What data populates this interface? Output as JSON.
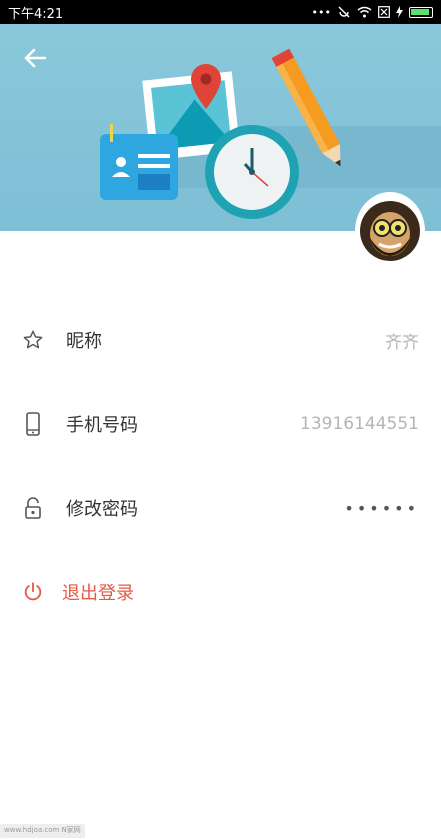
{
  "status_bar": {
    "time": "下午4:21",
    "signal_dots": "•••"
  },
  "header": {
    "back_icon": "arrow-left-icon"
  },
  "profile": {
    "rows": [
      {
        "icon": "star-outline-icon",
        "label": "昵称",
        "value": "齐齐"
      },
      {
        "icon": "phone-icon",
        "label": "手机号码",
        "value": "13916144551"
      },
      {
        "icon": "lock-icon",
        "label": "修改密码",
        "value": "••••••"
      }
    ],
    "logout": {
      "icon": "power-icon",
      "label": "退出登录"
    }
  },
  "watermark": {
    "text": "www.hdjoa.com N家网"
  },
  "colors": {
    "header_bg": "#8ac8db",
    "accent": "#e35a47",
    "value_text": "#b5b5b5"
  }
}
